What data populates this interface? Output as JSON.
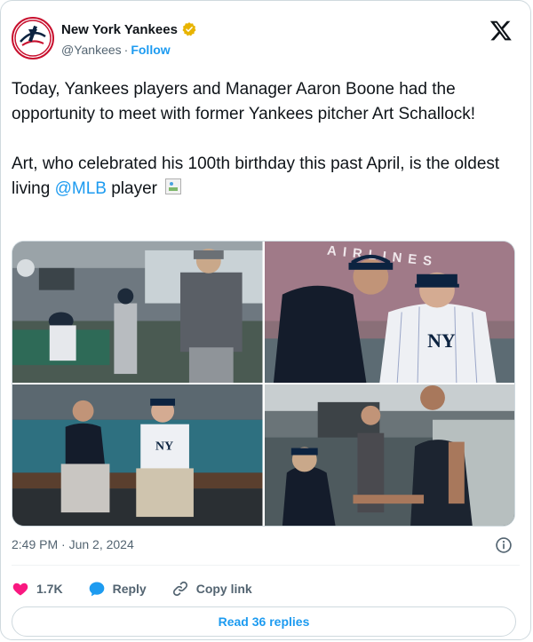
{
  "account": {
    "name": "New York Yankees",
    "handle": "@Yankees",
    "follow_label": "Follow",
    "separator": "·"
  },
  "tweet": {
    "paragraph1": "Today, Yankees players and Manager Aaron Boone had the opportunity to meet with former Yankees pitcher Art Schallock!",
    "paragraph2_prefix": "Art, who celebrated his 100th birthday this past April, is the oldest living ",
    "mention": "@MLB",
    "paragraph2_suffix": " player "
  },
  "photos": {
    "photo2_sign_text": "AIRLINES"
  },
  "timestamp": "2:49 PM · Jun 2, 2024",
  "actions": {
    "likes_count": "1.7K",
    "reply_label": "Reply",
    "copy_link_label": "Copy link"
  },
  "read_replies_label": "Read 36 replies",
  "colors": {
    "accent": "#1d9bf0",
    "like": "#f91880",
    "verified": "#e8b400",
    "yankees_navy": "#0c2340"
  },
  "icons": [
    "yankees-logo-icon",
    "verified-badge-icon",
    "x-logo-icon",
    "info-icon",
    "heart-icon",
    "reply-bubble-icon",
    "link-icon",
    "broken-image-icon"
  ]
}
